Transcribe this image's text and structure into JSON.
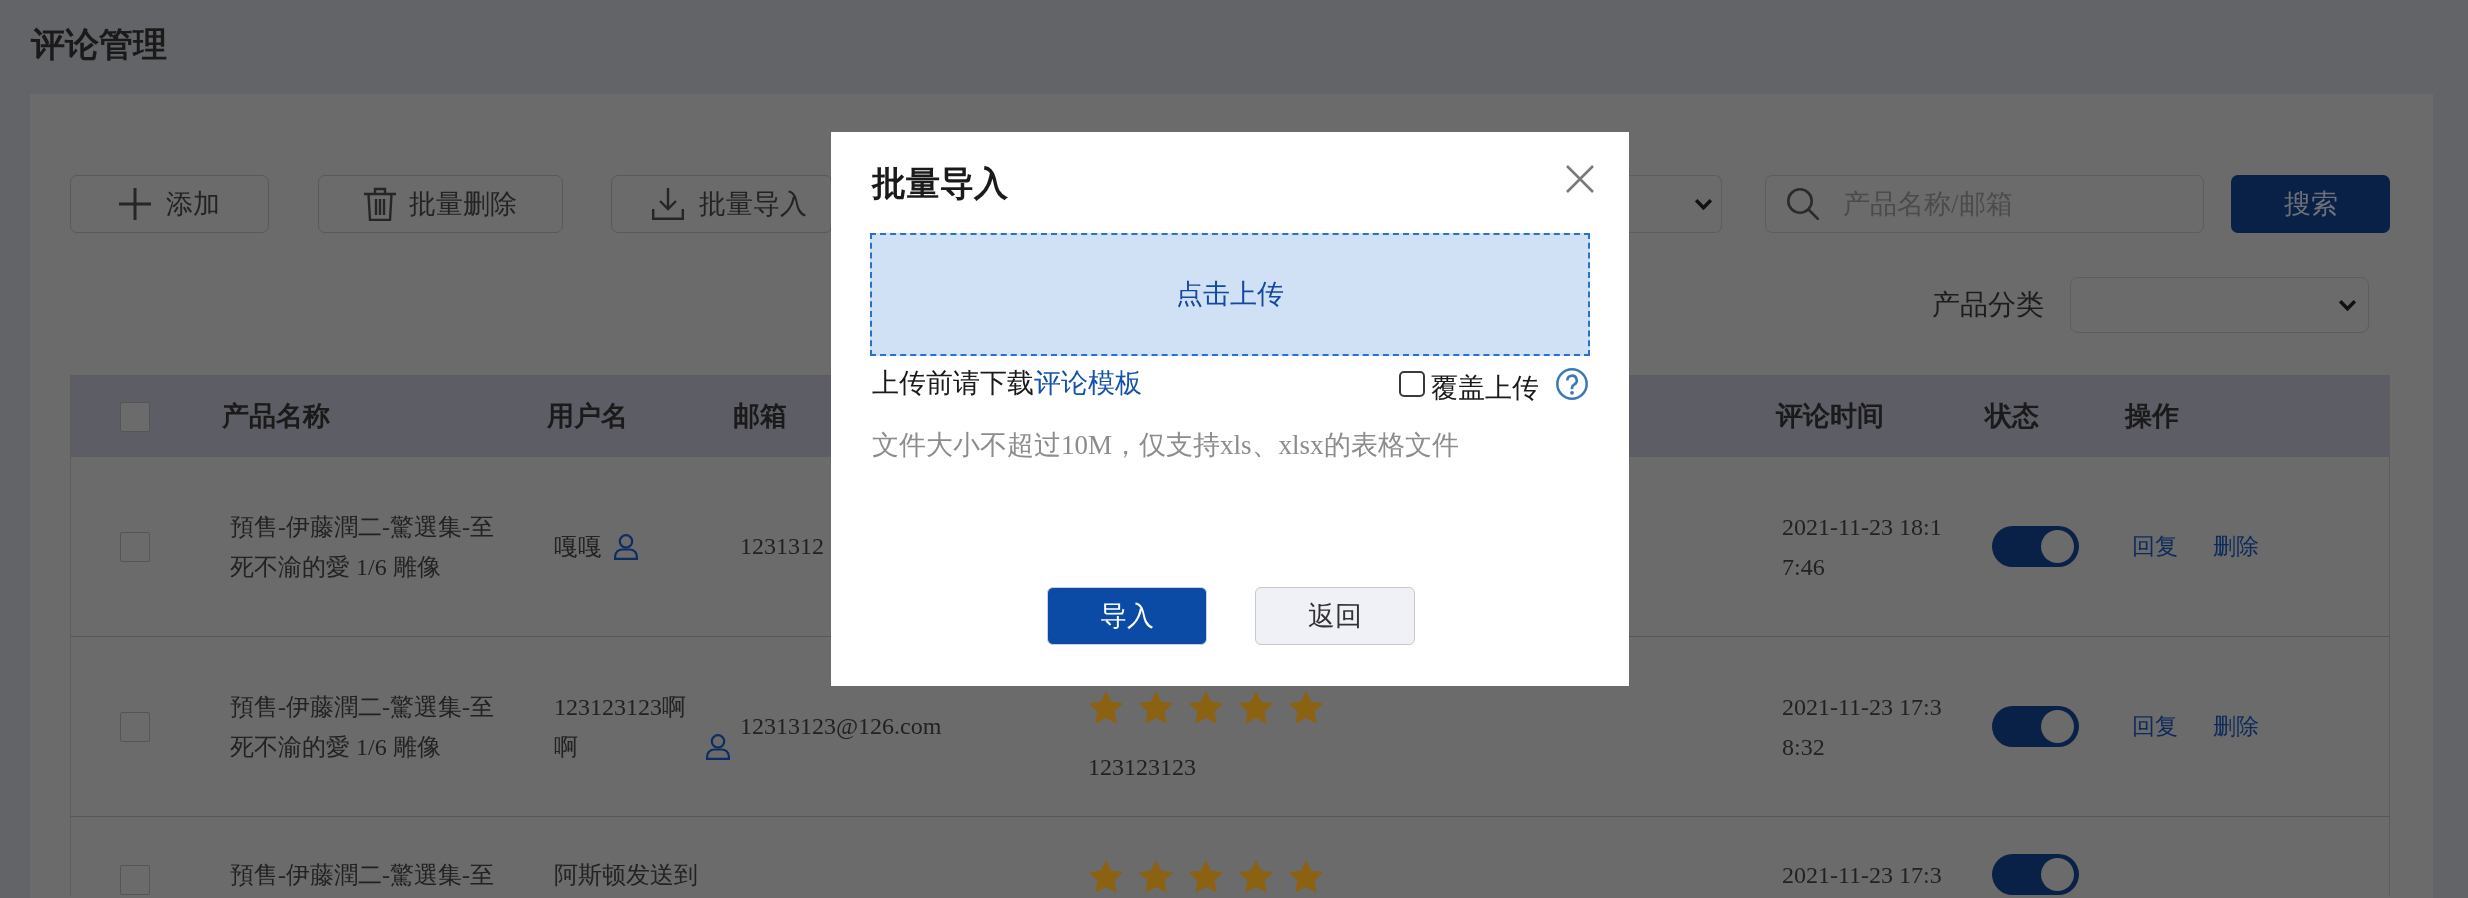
{
  "page": {
    "title": "评论管理"
  },
  "toolbar": {
    "buttons": [
      {
        "kind": "add",
        "label": "添加"
      },
      {
        "kind": "delete",
        "label": "批量删除"
      },
      {
        "kind": "import",
        "label": "批量导入"
      }
    ],
    "search": {
      "placeholder": "产品名称/邮箱"
    },
    "search_button": "搜索"
  },
  "category_filter": {
    "label": "产品分类"
  },
  "table": {
    "select_all": {
      "checked": false
    },
    "columns": [
      "产品名称",
      "用户名",
      "邮箱",
      "评论时间",
      "状态",
      "操作"
    ],
    "rows": [
      {
        "checked": false,
        "product": "預售-伊藤潤二-驚選集-至死不渝的愛 1/6 雕像",
        "username": "嘎嘎",
        "user_icon": true,
        "email": "1231312",
        "time": "2021-11-23 18:17:46",
        "on": true,
        "actions": [
          "回复",
          "删除"
        ]
      },
      {
        "checked": false,
        "product": "預售-伊藤潤二-驚選集-至死不渝的愛 1/6 雕像",
        "username": "123123123啊啊",
        "user_icon": true,
        "email": "12313123@126.com",
        "stars": 5,
        "comment": "123123123",
        "time": "2021-11-23 17:38:32",
        "on": true,
        "actions": [
          "回复",
          "删除"
        ]
      },
      {
        "checked": false,
        "product": "預售-伊藤潤二-驚選集-至",
        "username": "阿斯顿发送到",
        "user_icon": false,
        "stars": 5,
        "time": "2021-11-23 17:3",
        "on": true
      }
    ]
  },
  "dialog": {
    "title": "批量导入",
    "upload_area": "点击上传",
    "hint": {
      "text": "上传前请下载",
      "link": "评论模板"
    },
    "overwrite": {
      "label": "覆盖上传",
      "checked": false
    },
    "note": "文件大小不超过10M，仅支持xls、xlsx的表格文件",
    "buttons": [
      {
        "kind": "primary",
        "label": "导入"
      },
      {
        "kind": "secondary",
        "label": "返回"
      }
    ]
  }
}
